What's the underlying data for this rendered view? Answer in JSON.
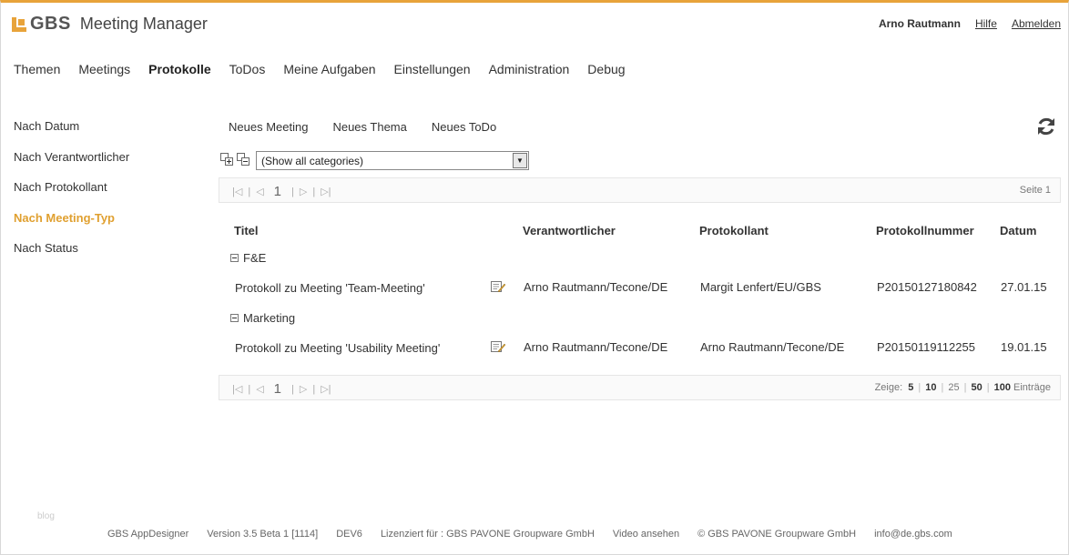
{
  "app": {
    "brand": "GBS",
    "title": "Meeting Manager",
    "accent_color": "#e8a33a"
  },
  "userbar": {
    "user": "Arno Rautmann",
    "help": "Hilfe",
    "logout": "Abmelden"
  },
  "mainnav": {
    "items": [
      "Themen",
      "Meetings",
      "Protokolle",
      "ToDos",
      "Meine Aufgaben",
      "Einstellungen",
      "Administration",
      "Debug"
    ],
    "active": "Protokolle"
  },
  "sidebar": {
    "items": [
      "Nach Datum",
      "Nach Verantwortlicher",
      "Nach Protokollant",
      "Nach Meeting-Typ",
      "Nach Status"
    ],
    "active": "Nach Meeting-Typ"
  },
  "actions": {
    "new_meeting": "Neues Meeting",
    "new_topic": "Neues Thema",
    "new_todo": "Neues ToDo"
  },
  "category_select": {
    "value": "(Show all categories)"
  },
  "pager": {
    "current_page": "1",
    "page_label": "Seite 1",
    "show_label": "Zeige:",
    "sizes": [
      "5",
      "10",
      "25",
      "50",
      "100"
    ],
    "entries_label": "Einträge"
  },
  "table": {
    "columns": {
      "title": "Titel",
      "responsible": "Verantwortlicher",
      "recorder": "Protokollant",
      "number": "Protokollnummer",
      "date": "Datum"
    },
    "groups": [
      {
        "name": "F&E",
        "rows": [
          {
            "title": "Protokoll zu Meeting 'Team-Meeting'",
            "responsible": "Arno Rautmann/Tecone/DE",
            "recorder": "Margit Lenfert/EU/GBS",
            "number": "P20150127180842",
            "date": "27.01.15"
          }
        ]
      },
      {
        "name": "Marketing",
        "rows": [
          {
            "title": "Protokoll zu Meeting 'Usability Meeting'",
            "responsible": "Arno Rautmann/Tecone/DE",
            "recorder": "Arno Rautmann/Tecone/DE",
            "number": "P20150119112255",
            "date": "19.01.15"
          }
        ]
      }
    ]
  },
  "footer": {
    "watermark": "blog",
    "designer": "GBS AppDesigner",
    "version": "Version 3.5 Beta 1 [1114]",
    "env": "DEV6",
    "license": "Lizenziert für : GBS PAVONE Groupware GmbH",
    "video": "Video ansehen",
    "copyright": "© GBS PAVONE Groupware GmbH",
    "email": "info@de.gbs.com"
  }
}
